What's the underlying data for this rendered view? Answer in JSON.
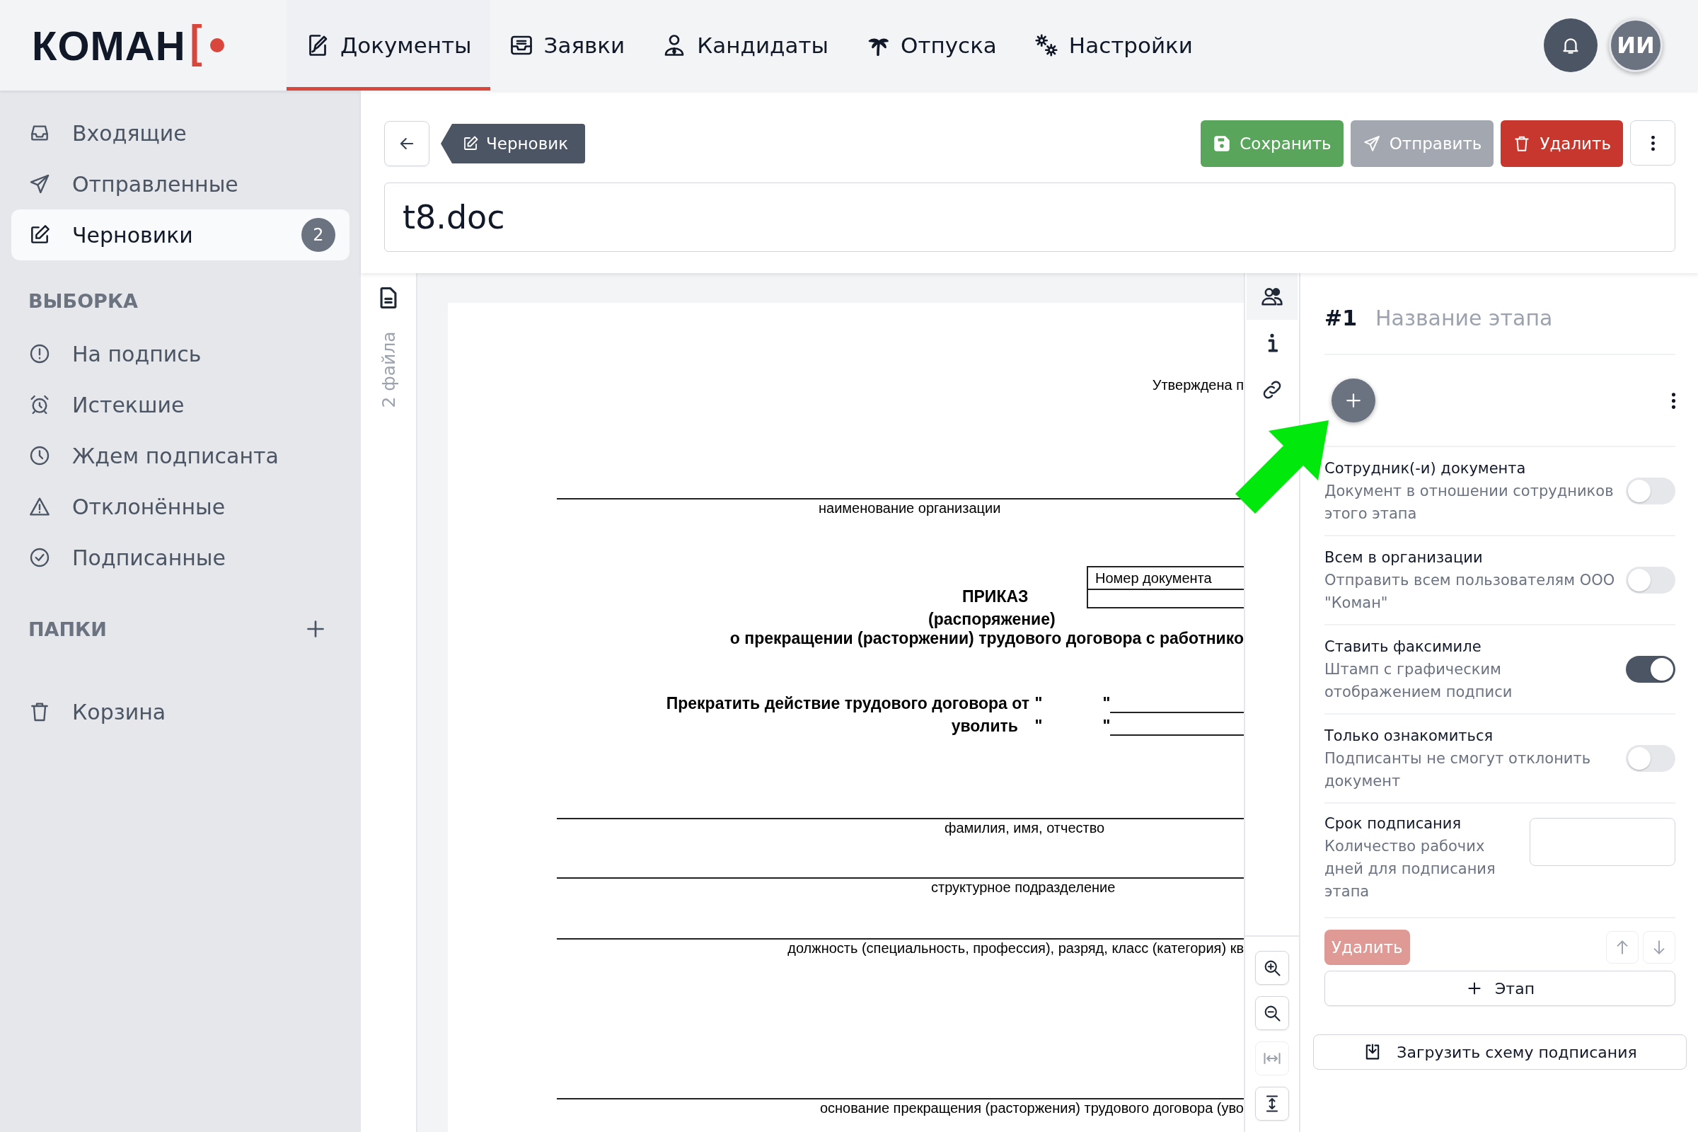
{
  "logo": {
    "text": "КОМАН"
  },
  "nav": [
    {
      "label": "Документы",
      "selected": true
    },
    {
      "label": "Заявки",
      "selected": false
    },
    {
      "label": "Кандидаты",
      "selected": false
    },
    {
      "label": "Отпуска",
      "selected": false
    },
    {
      "label": "Настройки",
      "selected": false
    }
  ],
  "user": {
    "initials": "ИИ"
  },
  "sidebar": {
    "mailboxes": [
      {
        "label": "Входящие",
        "selected": false
      },
      {
        "label": "Отправленные",
        "selected": false
      },
      {
        "label": "Черновики",
        "selected": true,
        "badge": "2"
      }
    ],
    "filter_heading": "ВЫБОРКА",
    "filters": [
      {
        "label": "На подпись",
        "selected": false
      },
      {
        "label": "Истекшие",
        "selected": false
      },
      {
        "label": "Ждем подписанта",
        "selected": false
      },
      {
        "label": "Отклонённые",
        "selected": false
      },
      {
        "label": "Подписанные",
        "selected": false
      }
    ],
    "folders_heading": "ПАПКИ",
    "trash": {
      "label": "Корзина",
      "selected": false
    }
  },
  "toolbar": {
    "status": "Черновик",
    "buttons": [
      {
        "kind": "save",
        "label": "Сохранить",
        "disabled": false
      },
      {
        "kind": "send",
        "label": "Отправить",
        "disabled": true
      },
      {
        "kind": "delete",
        "label": "Удалить",
        "disabled": false
      }
    ]
  },
  "title_field": {
    "value": "t8.doc"
  },
  "files": {
    "count_label": "2 файла"
  },
  "document": {
    "approved_note": "Утверждена п",
    "org_caption": "наименование организации",
    "number_label": "Номер документа",
    "heading": "ПРИКАЗ",
    "subheading": "(распоряжение)",
    "subject": "о прекращении (расторжении) трудового договора с работнико",
    "terminate_label": "Прекратить действие трудового договора от",
    "dismiss_label": "уволить",
    "quote": "\"",
    "name_caption": "фамилия, имя, отчество",
    "dept_caption": "структурное подразделение",
    "position_caption": "должность (специальность, профессия), разряд, класс (категория) кв",
    "basis_caption": "основание прекращения (расторжения) трудового договора (уво"
  },
  "side_tabs": [
    {
      "selected": true
    },
    {
      "selected": false
    },
    {
      "selected": false
    }
  ],
  "viewer_tools": [
    {
      "disabled": false
    },
    {
      "disabled": false
    },
    {
      "disabled": true
    },
    {
      "disabled": false
    }
  ],
  "stage": {
    "number": "#1",
    "name_placeholder": "Название этапа",
    "options": [
      {
        "title": "Сотрудник(-и) документа",
        "description": "Документ в отношении сотрудников этого этапа",
        "on": false
      },
      {
        "title": "Всем в организации",
        "description": "Отправить всем пользователям ООО \"Коман\"",
        "on": false
      },
      {
        "title": "Ставить факсимиле",
        "description": "Штамп с графическим отображением подписи",
        "on": true
      },
      {
        "title": "Только ознакомиться",
        "description": "Подписанты не смогут отклонить документ",
        "on": false
      }
    ],
    "deadline": {
      "title": "Срок подписания",
      "description": "Количество рабочих дней для подписания этапа"
    },
    "delete_button": {
      "label": "Удалить",
      "disabled": true
    },
    "move_buttons": [
      {
        "disabled": true
      },
      {
        "disabled": true
      }
    ],
    "add_stage_label": "Этап",
    "upload_label": "Загрузить схему подписания"
  }
}
